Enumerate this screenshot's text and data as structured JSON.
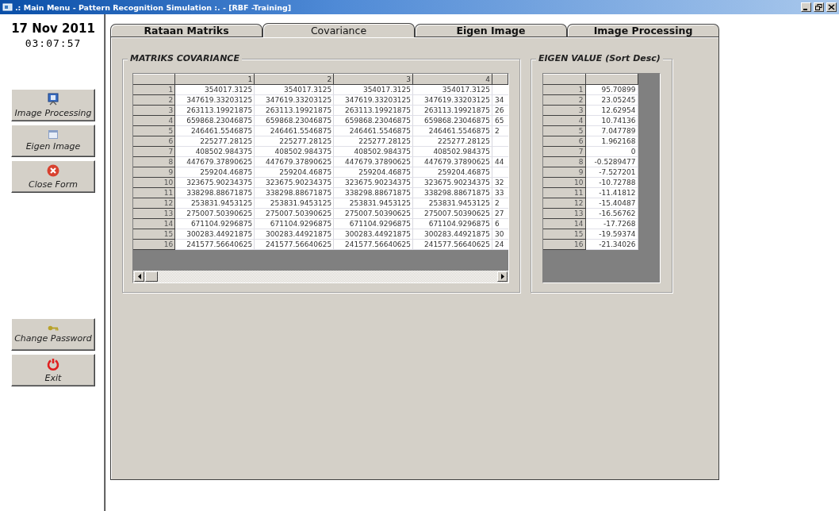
{
  "window": {
    "title": ".: Main Menu - Pattern Recognition Simulation :. - [RBF -Training]"
  },
  "sidebar": {
    "date": "17 Nov 2011",
    "time": "03:07:57",
    "top_buttons": [
      {
        "label": "Image Processing",
        "kind": "projector"
      },
      {
        "label": "Eigen Image",
        "kind": "window"
      },
      {
        "label": "Close Form",
        "kind": "close"
      }
    ],
    "bottom_buttons": [
      {
        "label": "Change Password",
        "kind": "key"
      },
      {
        "label": "Exit",
        "kind": "power"
      }
    ]
  },
  "tabs": [
    {
      "label": "Rataan Matriks",
      "selected": false
    },
    {
      "label": "Covariance",
      "selected": true
    },
    {
      "label": "Eigen Image",
      "selected": false
    },
    {
      "label": "Image Processing",
      "selected": false
    }
  ],
  "covariance": {
    "title": "MATRIKS COVARIANCE",
    "columns": [
      "1",
      "2",
      "3",
      "4"
    ],
    "rows": [
      {
        "header": "1",
        "cells": [
          "354017.3125",
          "354017.3125",
          "354017.3125",
          "354017.3125"
        ]
      },
      {
        "header": "2",
        "cells": [
          "347619.33203125",
          "347619.33203125",
          "347619.33203125",
          "347619.33203125"
        ],
        "cut_cell": "34"
      },
      {
        "header": "3",
        "cells": [
          "263113.19921875",
          "263113.19921875",
          "263113.19921875",
          "263113.19921875"
        ],
        "cut_cell": "26"
      },
      {
        "header": "4",
        "cells": [
          "659868.23046875",
          "659868.23046875",
          "659868.23046875",
          "659868.23046875"
        ],
        "cut_cell": "65"
      },
      {
        "header": "5",
        "cells": [
          "246461.5546875",
          "246461.5546875",
          "246461.5546875",
          "246461.5546875"
        ],
        "cut_cell": "2"
      },
      {
        "header": "6",
        "cells": [
          "225277.28125",
          "225277.28125",
          "225277.28125",
          "225277.28125"
        ]
      },
      {
        "header": "7",
        "cells": [
          "408502.984375",
          "408502.984375",
          "408502.984375",
          "408502.984375"
        ]
      },
      {
        "header": "8",
        "cells": [
          "447679.37890625",
          "447679.37890625",
          "447679.37890625",
          "447679.37890625"
        ],
        "cut_cell": "44"
      },
      {
        "header": "9",
        "cells": [
          "259204.46875",
          "259204.46875",
          "259204.46875",
          "259204.46875"
        ]
      },
      {
        "header": "10",
        "cells": [
          "323675.90234375",
          "323675.90234375",
          "323675.90234375",
          "323675.90234375"
        ],
        "cut_cell": "32"
      },
      {
        "header": "11",
        "cells": [
          "338298.88671875",
          "338298.88671875",
          "338298.88671875",
          "338298.88671875"
        ],
        "cut_cell": "33"
      },
      {
        "header": "12",
        "cells": [
          "253831.9453125",
          "253831.9453125",
          "253831.9453125",
          "253831.9453125"
        ],
        "cut_cell": "2"
      },
      {
        "header": "13",
        "cells": [
          "275007.50390625",
          "275007.50390625",
          "275007.50390625",
          "275007.50390625"
        ],
        "cut_cell": "27"
      },
      {
        "header": "14",
        "cells": [
          "671104.9296875",
          "671104.9296875",
          "671104.9296875",
          "671104.9296875"
        ],
        "cut_cell": "6"
      },
      {
        "header": "15",
        "cells": [
          "300283.44921875",
          "300283.44921875",
          "300283.44921875",
          "300283.44921875"
        ],
        "cut_cell": "30"
      },
      {
        "header": "16",
        "cells": [
          "241577.56640625",
          "241577.56640625",
          "241577.56640625",
          "241577.56640625"
        ],
        "cut_cell": "24"
      }
    ]
  },
  "eigen": {
    "title": "EIGEN VALUE (Sort Desc)",
    "rows": [
      {
        "header": "1",
        "value": "95.70899"
      },
      {
        "header": "2",
        "value": "23.05245"
      },
      {
        "header": "3",
        "value": "12.62954"
      },
      {
        "header": "4",
        "value": "10.74136"
      },
      {
        "header": "5",
        "value": "7.047789"
      },
      {
        "header": "6",
        "value": "1.962168"
      },
      {
        "header": "7",
        "value": "0"
      },
      {
        "header": "8",
        "value": "-0.5289477"
      },
      {
        "header": "9",
        "value": "-7.527201"
      },
      {
        "header": "10",
        "value": "-10.72788"
      },
      {
        "header": "11",
        "value": "-11.41812"
      },
      {
        "header": "12",
        "value": "-15.40487"
      },
      {
        "header": "13",
        "value": "-16.56762"
      },
      {
        "header": "14",
        "value": "-17.7268"
      },
      {
        "header": "15",
        "value": "-19.59374"
      },
      {
        "header": "16",
        "value": "-21.34026"
      }
    ]
  }
}
